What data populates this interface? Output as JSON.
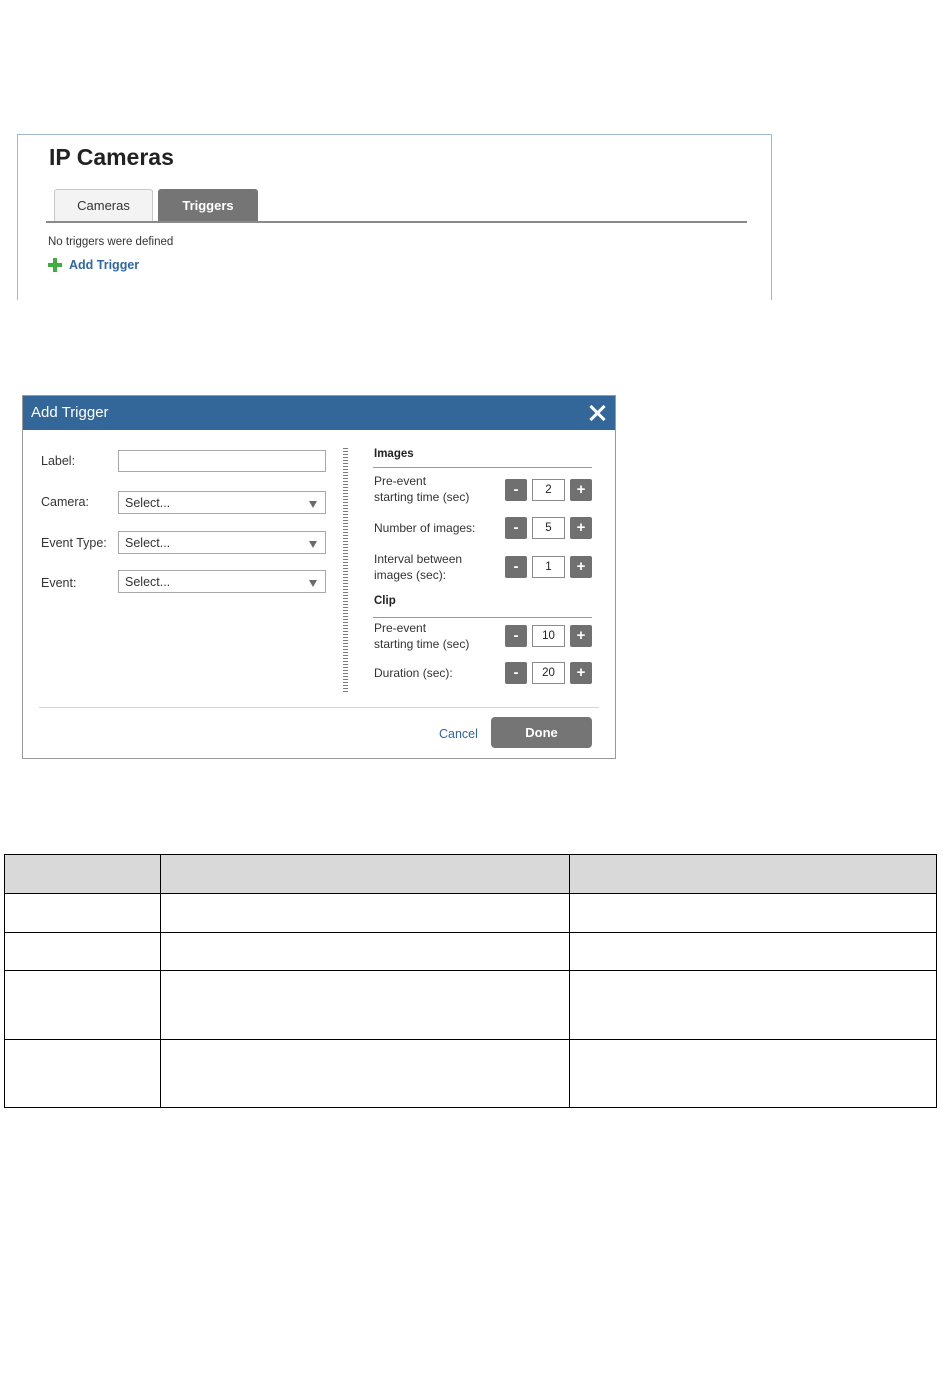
{
  "ip_cameras": {
    "title": "IP Cameras",
    "tabs": [
      {
        "label": "Cameras",
        "active": false
      },
      {
        "label": "Triggers",
        "active": true
      }
    ],
    "empty_message": "No triggers were defined",
    "add_trigger_label": "Add Trigger",
    "add_icon": "plus-icon"
  },
  "dialog": {
    "title": "Add Trigger",
    "close_icon": "close-icon",
    "fields": {
      "label": {
        "label": "Label:",
        "value": ""
      },
      "camera": {
        "label": "Camera:",
        "value": "Select..."
      },
      "event_type": {
        "label": "Event Type:",
        "value": "Select..."
      },
      "event": {
        "label": "Event:",
        "value": "Select..."
      }
    },
    "images": {
      "title": "Images",
      "pre_event": {
        "label_line1": "Pre-event",
        "label_line2": "starting time (sec)",
        "value": "2"
      },
      "number": {
        "label": "Number of images:",
        "value": "5"
      },
      "interval": {
        "label_line1": "Interval between",
        "label_line2": "images (sec):",
        "value": "1"
      }
    },
    "clip": {
      "title": "Clip",
      "pre_event": {
        "label_line1": "Pre-event",
        "label_line2": "starting time (sec)",
        "value": "10"
      },
      "duration": {
        "label": "Duration (sec):",
        "value": "20"
      }
    },
    "stepper_minus": "-",
    "stepper_plus": "+",
    "cancel_label": "Cancel",
    "done_label": "Done"
  },
  "colors": {
    "header_blue": "#336699",
    "link_blue": "#2f66a8",
    "add_green": "#3fae3f",
    "button_gray": "#757575",
    "table_header_gray": "#d9d9d9"
  }
}
